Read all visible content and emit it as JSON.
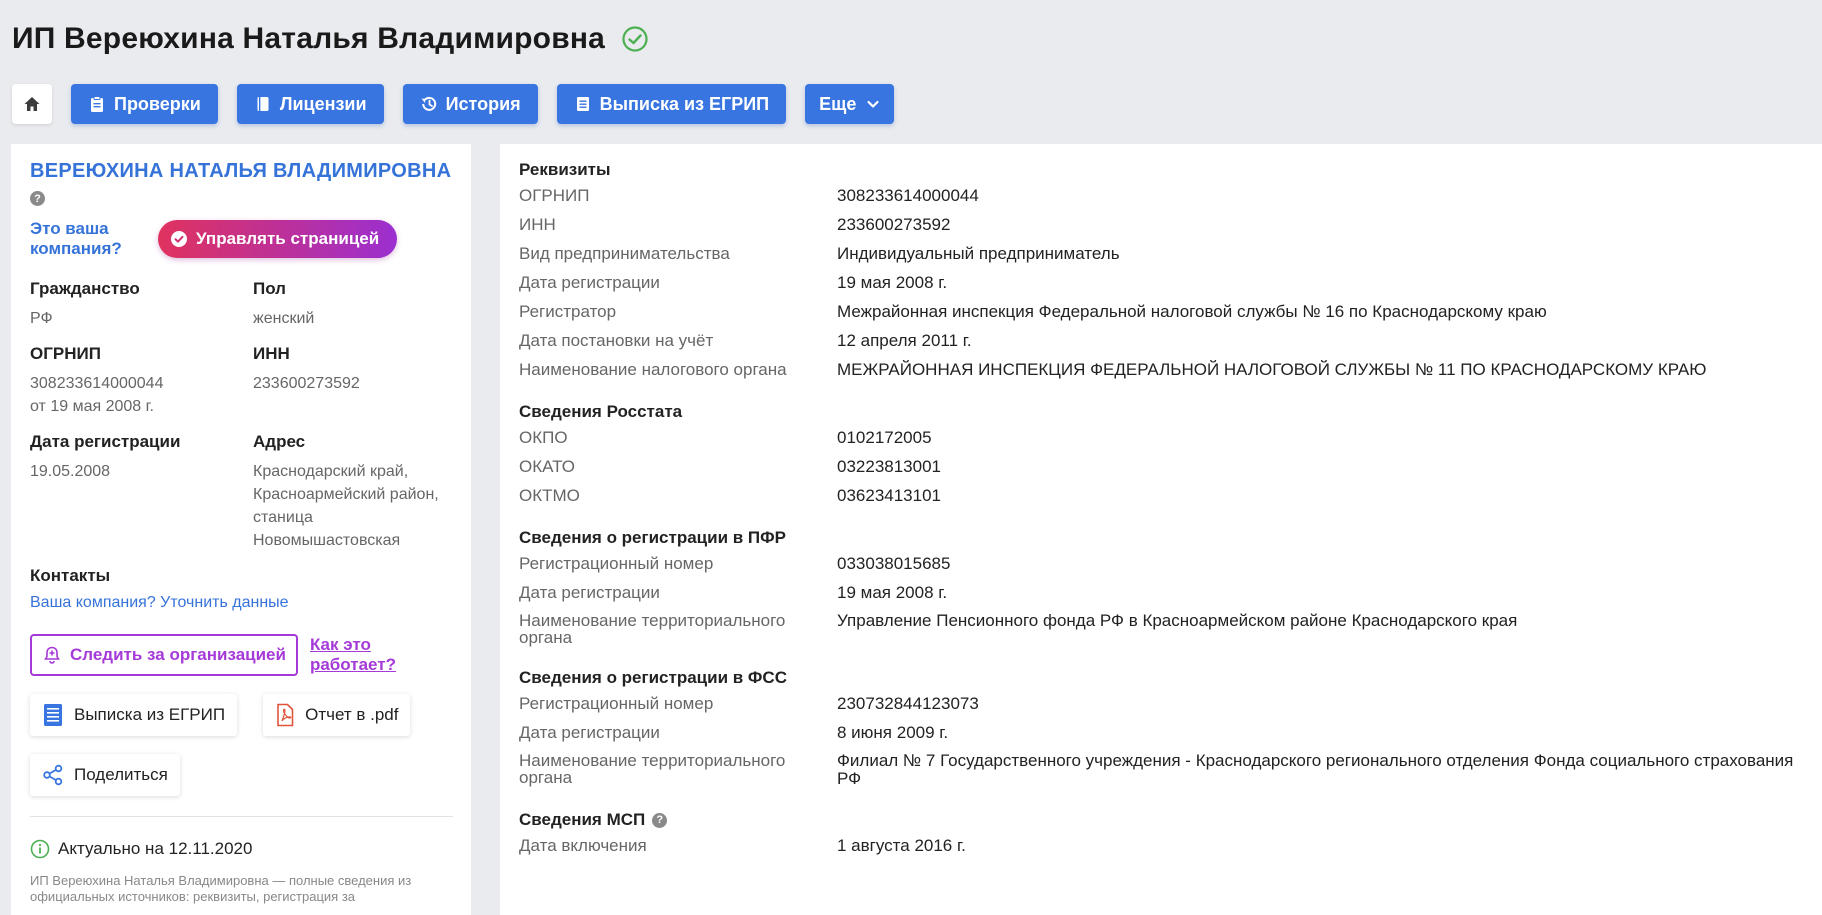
{
  "header": {
    "title": "ИП Вереюхина Наталья Владимировна",
    "verified_color": "#4caf50"
  },
  "nav": {
    "home_icon": "home-icon",
    "buttons": [
      {
        "label": "Проверки",
        "icon": "clipboard-icon"
      },
      {
        "label": "Лицензии",
        "icon": "book-icon"
      },
      {
        "label": "История",
        "icon": "history-icon"
      },
      {
        "label": "Выписка из ЕГРИП",
        "icon": "document-icon"
      },
      {
        "label": "Еще",
        "icon": "chevron-down-icon"
      }
    ],
    "accent": "#3875e0"
  },
  "left": {
    "company_name": "ВЕРЕЮХИНА НАТАЛЬЯ ВЛАДИМИРОВНА",
    "help_glyph": "?",
    "your_company_q": "Это ваша компания?",
    "manage_label": "Управлять страницей",
    "citizenship_label": "Гражданство",
    "citizenship_value": "РФ",
    "gender_label": "Пол",
    "gender_value": "женский",
    "ogrnip_label": "ОГРНИП",
    "ogrnip_value": "308233614000044",
    "ogrnip_date": "от 19 мая 2008 г.",
    "inn_label": "ИНН",
    "inn_value": "233600273592",
    "reg_date_label": "Дата регистрации",
    "reg_date_value": "19.05.2008",
    "address_label": "Адрес",
    "address_value": "Краснодарский край, Красноармейский район, станица Новомышастовская",
    "contacts_label": "Контакты",
    "contacts_link": "Ваша компания? Уточнить данные",
    "follow_label": "Следить за организацией",
    "how_label": "Как это работает?",
    "egrip_label": "Выписка из ЕГРИП",
    "pdf_label": "Отчет в .pdf",
    "share_label": "Поделиться",
    "actual_label": "Актуально на 12.11.2020",
    "footer_text": "ИП Вереюхина Наталья Владимировна — полные сведения из официальных источников: реквизиты, регистрация за"
  },
  "right": {
    "sections": [
      {
        "title": "Реквизиты",
        "rows": [
          {
            "k": "ОГРНИП",
            "v": "308233614000044"
          },
          {
            "k": "ИНН",
            "v": "233600273592"
          },
          {
            "k": "Вид предпринимательства",
            "v": "Индивидуальный предприниматель"
          },
          {
            "k": "Дата регистрации",
            "v": "19 мая 2008 г."
          },
          {
            "k": "Регистратор",
            "v": "Межрайонная инспекция Федеральной налоговой службы № 16 по Краснодарскому краю"
          },
          {
            "k": "Дата постановки на учёт",
            "v": "12 апреля 2011 г."
          },
          {
            "k": "Наименование налогового органа",
            "v": "МЕЖРАЙОННАЯ ИНСПЕКЦИЯ ФЕДЕРАЛЬНОЙ НАЛОГОВОЙ СЛУЖБЫ № 11 ПО КРАСНОДАРСКОМУ КРАЮ"
          }
        ]
      },
      {
        "title": "Сведения Росстата",
        "rows": [
          {
            "k": "ОКПО",
            "v": "0102172005"
          },
          {
            "k": "ОКАТО",
            "v": "03223813001"
          },
          {
            "k": "ОКТМО",
            "v": "03623413101"
          }
        ]
      },
      {
        "title": "Сведения о регистрации в ПФР",
        "rows": [
          {
            "k": "Регистрационный номер",
            "v": "033038015685"
          },
          {
            "k": "Дата регистрации",
            "v": "19 мая 2008 г."
          },
          {
            "k": "Наименование территориального органа",
            "v": "Управление Пенсионного фонда РФ в Красноармейском районе Краснодарского края"
          }
        ]
      },
      {
        "title": "Сведения о регистрации в ФСС",
        "rows": [
          {
            "k": "Регистрационный номер",
            "v": "230732844123073"
          },
          {
            "k": "Дата регистрации",
            "v": "8 июня 2009 г."
          },
          {
            "k": "Наименование территориального органа",
            "v": "Филиал № 7 Государственного учреждения - Краснодарского регионального отделения Фонда социального страхования РФ"
          }
        ]
      },
      {
        "title": "Сведения МСП",
        "help_glyph": "?",
        "rows": [
          {
            "k": "Дата включения",
            "v": "1 августа 2016 г."
          }
        ]
      }
    ]
  }
}
